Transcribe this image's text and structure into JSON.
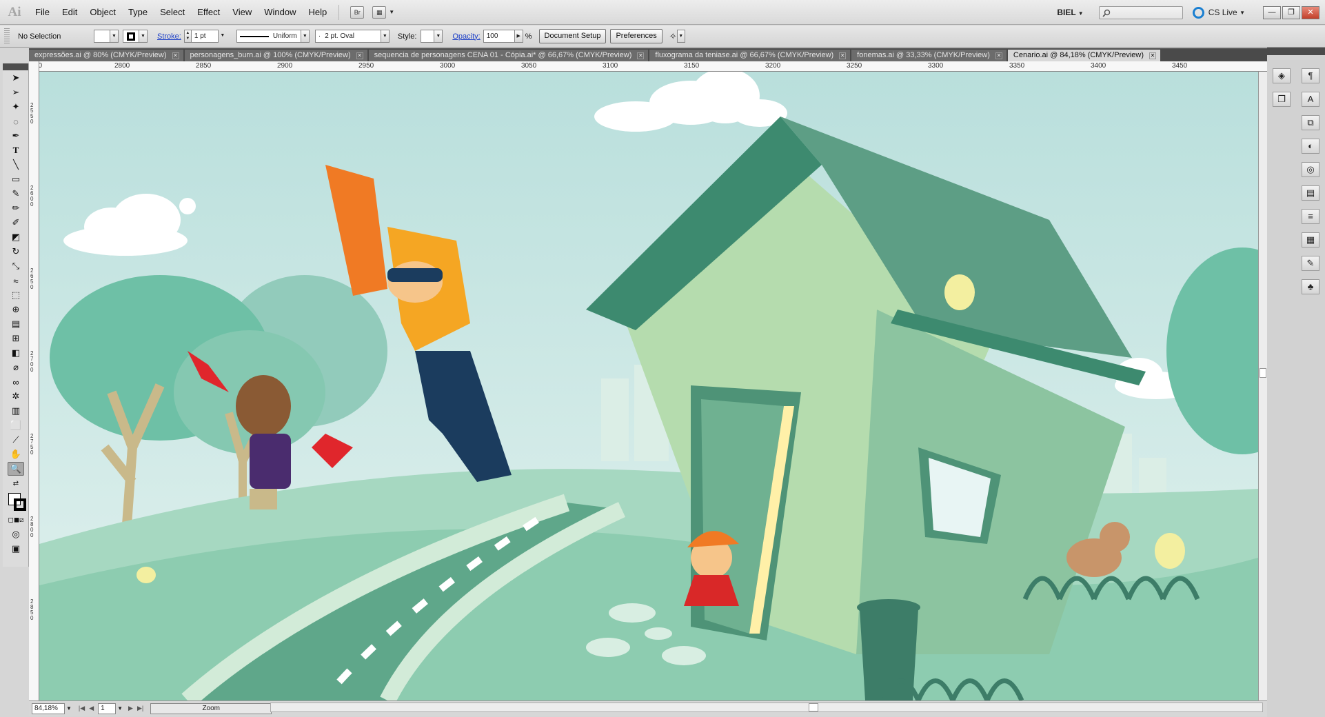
{
  "app": {
    "logo": "Ai"
  },
  "menu": [
    "File",
    "Edit",
    "Object",
    "Type",
    "Select",
    "Effect",
    "View",
    "Window",
    "Help"
  ],
  "menubar_right": {
    "workspace": "BIEL",
    "cs_live": "CS Live"
  },
  "window_buttons": [
    "minimize",
    "restore",
    "close"
  ],
  "control": {
    "selection": "No Selection",
    "stroke_label": "Stroke:",
    "stroke_value": "1 pt",
    "profile": "Uniform",
    "brush": "2 pt. Oval",
    "style_label": "Style:",
    "opacity_label": "Opacity:",
    "opacity_value": "100",
    "percent": "%",
    "doc_setup": "Document Setup",
    "preferences": "Preferences"
  },
  "tabs": [
    {
      "label": "expressões.ai @ 80% (CMYK/Preview)",
      "active": false
    },
    {
      "label": "personagens_burn.ai @ 100% (CMYK/Preview)",
      "active": false
    },
    {
      "label": "sequencia de personagens CENA 01 - Cópia.ai* @ 66,67% (CMYK/Preview)",
      "active": false
    },
    {
      "label": "fluxograma da teniase.ai @ 66,67% (CMYK/Preview)",
      "active": false
    },
    {
      "label": "fonemas.ai @ 33,33% (CMYK/Preview)",
      "active": false
    },
    {
      "label": "Cenario.ai @ 84,18% (CMYK/Preview)",
      "active": true
    }
  ],
  "ruler_top": [
    "2800",
    "2850",
    "2900",
    "2950",
    "3000",
    "3050",
    "3100",
    "3150",
    "3200",
    "3250",
    "3300",
    "3350",
    "3400",
    "3450"
  ],
  "ruler_left": [
    "2550",
    "2600",
    "2650",
    "2700",
    "2750",
    "2800",
    "2850"
  ],
  "status": {
    "zoom": "84,18%",
    "artboard": "1",
    "tool": "Zoom"
  },
  "colors": {
    "sky": "#cfe8e3",
    "house_wall": "#b5dcae",
    "roof": "#5d9e85",
    "ground": "#8dccb0",
    "road": "#5fa78a",
    "tree": "#6ec0a6"
  }
}
